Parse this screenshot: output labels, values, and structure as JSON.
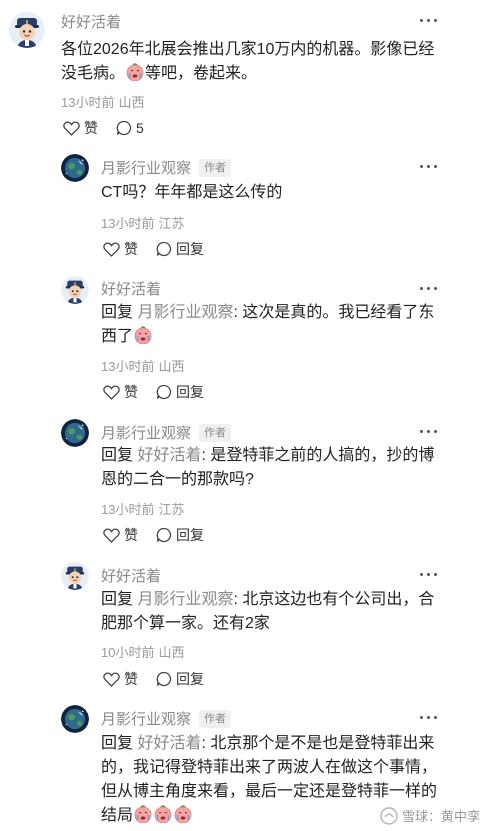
{
  "root": {
    "author": "好好活着",
    "content": "各位2026年北展会推出几家10万内的机器。影像已经没毛病。",
    "content_tail": "等吧，卷起来。",
    "time": "13小时前",
    "location": "山西",
    "like_label": "赞",
    "reply_count": "5"
  },
  "replies": [
    {
      "author": "月影行业观察",
      "badge": "作者",
      "prefix": "",
      "mention": "",
      "text": "CT吗？年年都是这么传的",
      "time": "13小时前",
      "location": "江苏",
      "like_label": "赞",
      "reply_label": "回复"
    },
    {
      "author": "好好活着",
      "badge": "",
      "prefix": "回复",
      "mention": "月影行业观察",
      "text": ": 这次是真的。我已经看了东西了",
      "time": "13小时前",
      "location": "山西",
      "like_label": "赞",
      "reply_label": "回复"
    },
    {
      "author": "月影行业观察",
      "badge": "作者",
      "prefix": "回复",
      "mention": "好好活着",
      "text": ": 是登特菲之前的人搞的，抄的博恩的二合一的那款吗?",
      "time": "13小时前",
      "location": "江苏",
      "like_label": "赞",
      "reply_label": "回复"
    },
    {
      "author": "好好活着",
      "badge": "",
      "prefix": "回复",
      "mention": "月影行业观察",
      "text": ": 北京这边也有个公司出，合肥那个算一家。还有2家",
      "time": "10小时前",
      "location": "山西",
      "like_label": "赞",
      "reply_label": "回复"
    },
    {
      "author": "月影行业观察",
      "badge": "作者",
      "prefix": "回复",
      "mention": "好好活着",
      "text": ": 北京那个是不是也是登特菲出来的，我记得登特菲出来了两波人在做这个事情，但从博主角度来看，最后一定还是登特菲一样的结局",
      "time": "",
      "location": "",
      "like_label": "",
      "reply_label": ""
    }
  ],
  "watermark": "雪球：黄中孪",
  "icons": {
    "more": "more-dots-icon",
    "like": "heart-icon",
    "comment": "comment-bubble-icon",
    "emoji_tear": "crying-face-emoji",
    "emoji_laugh": "laughing-face-emoji"
  },
  "colors": {
    "muted": "#8a8a8a",
    "text": "#222222",
    "badge_bg": "#f0f0f0"
  }
}
